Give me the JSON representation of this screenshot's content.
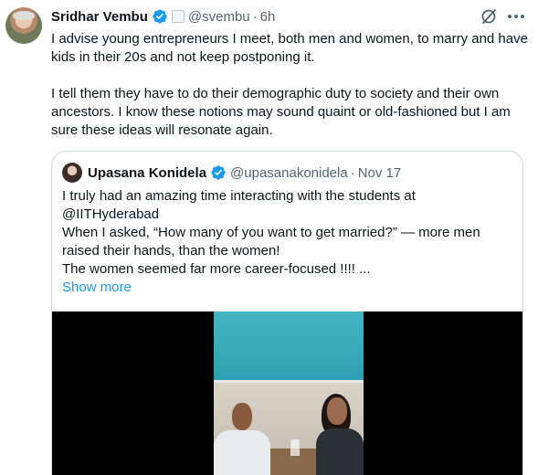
{
  "tweet": {
    "author_name": "Sridhar Vembu",
    "handle": "@svembu",
    "separator": "·",
    "time": "6h",
    "paragraphs": [
      "I advise young entrepreneurs I meet, both men and women, to marry and have kids in their 20s and not keep postponing it.",
      "I tell them they have to do their demographic duty to society and their own ancestors. I know these notions may sound quaint or old-fashioned but I am sure these ideas will resonate again."
    ]
  },
  "quoted": {
    "author_name": "Upasana Konidela",
    "handle": "@upasanakonidela",
    "separator": "·",
    "date": "Nov 17",
    "lines": [
      "I truly had an amazing time interacting with the students at @IITHyderabad",
      "When I asked, “How many of you want to get married?” — more men raised their hands, than the women!",
      "The women seemed far more career-focused !!!! ..."
    ],
    "show_more": "Show more"
  },
  "colors": {
    "text": "#0f1419",
    "secondary": "#536471",
    "accent": "#1d9bf0",
    "border": "#cfd9de"
  },
  "icons": [
    "verified-badge-icon",
    "affiliation-badge-icon",
    "grok-icon",
    "more-icon"
  ]
}
